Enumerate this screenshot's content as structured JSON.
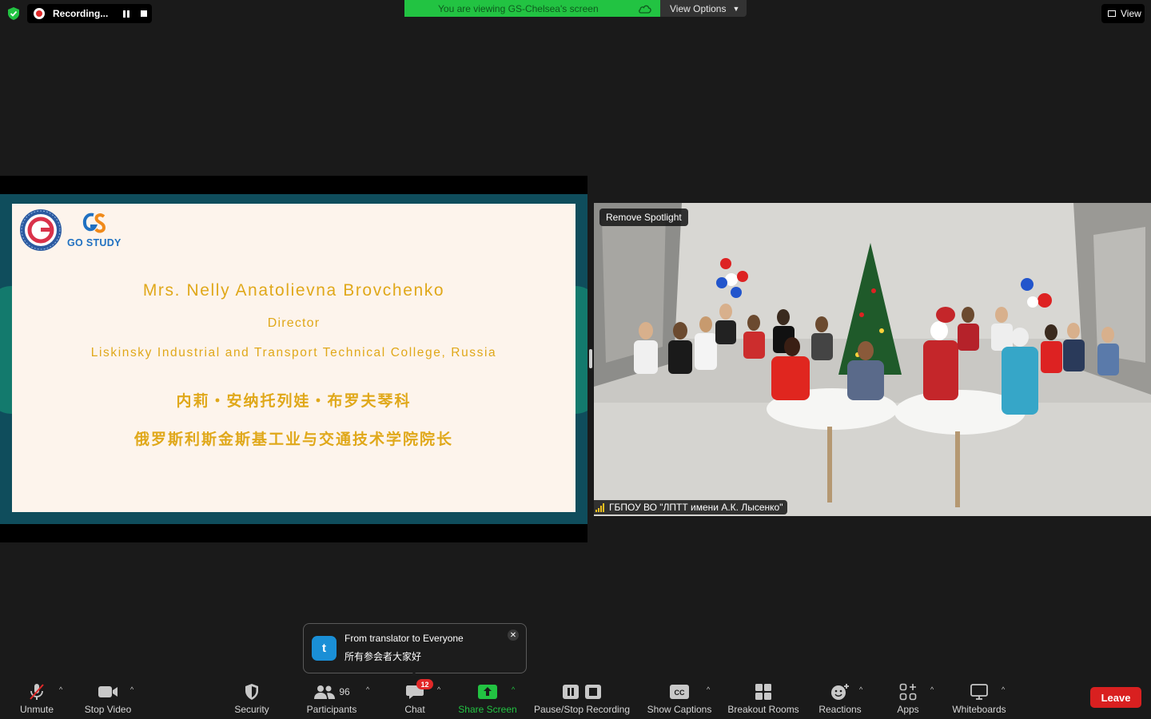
{
  "top_bar": {
    "recording_label": "Recording...",
    "viewing_banner": "You are viewing GS-Chelsea's screen",
    "view_options_label": "View Options",
    "view_label": "View"
  },
  "slide": {
    "logo_text": "GO STUDY",
    "name_en": "Mrs. Nelly Anatolievna Brovchenko",
    "title_en": "Director",
    "college_en": "Liskinsky Industrial and Transport Technical College, Russia",
    "name_cn": "内莉・安纳托列娃・布罗夫琴科",
    "title_cn": "俄罗斯利斯金斯基工业与交通技术学院院长"
  },
  "video": {
    "remove_spotlight_label": "Remove Spotlight",
    "participant_name": "ГБПОУ ВО \"ЛПТТ имени А.К. Лысенко\""
  },
  "chat_toast": {
    "avatar_letter": "t",
    "from": "From translator to Everyone",
    "message": "所有参会者大家好"
  },
  "toolbar": {
    "unmute": "Unmute",
    "stop_video": "Stop Video",
    "security": "Security",
    "participants": "Participants",
    "participants_count": "96",
    "chat": "Chat",
    "chat_badge": "12",
    "share_screen": "Share Screen",
    "pause_stop_recording": "Pause/Stop Recording",
    "show_captions": "Show Captions",
    "breakout_rooms": "Breakout Rooms",
    "reactions": "Reactions",
    "apps": "Apps",
    "whiteboards": "Whiteboards",
    "leave": "Leave"
  },
  "colors": {
    "accent_green": "#22c342",
    "leave_red": "#d92020",
    "slide_gold": "#e0a81a",
    "slide_frame": "#0f4d5c"
  }
}
